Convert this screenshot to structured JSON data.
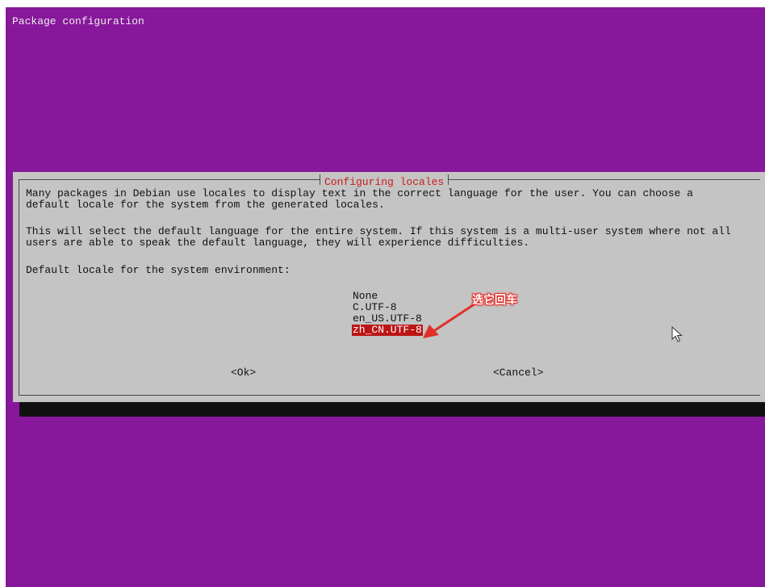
{
  "window": {
    "title": "Package configuration"
  },
  "dialog": {
    "title": "Configuring locales",
    "paragraphs": [
      "Many packages in Debian use locales to display text in the correct language for the user. You can choose a\ndefault locale for the system from the generated locales.",
      "This will select the default language for the entire system. If this system is a multi-user system where not all\nusers are able to speak the default language, they will experience difficulties.",
      "Default locale for the system environment:"
    ],
    "options": [
      "None",
      "C.UTF-8",
      "en_US.UTF-8",
      "zh_CN.UTF-8"
    ],
    "selected_option": "zh_CN.UTF-8",
    "buttons": {
      "ok": "<Ok>",
      "cancel": "<Cancel>"
    }
  },
  "annotation": {
    "text": "选它回车"
  },
  "colors": {
    "desktop": "#87189b",
    "dialog_bg": "#c4c4c4",
    "title": "#c81c1c",
    "selection": "#bc1515",
    "annotation": "#e0302a"
  },
  "icons": {
    "cursor": "mouse-pointer-icon",
    "arrow": "annotation-arrow-icon"
  }
}
